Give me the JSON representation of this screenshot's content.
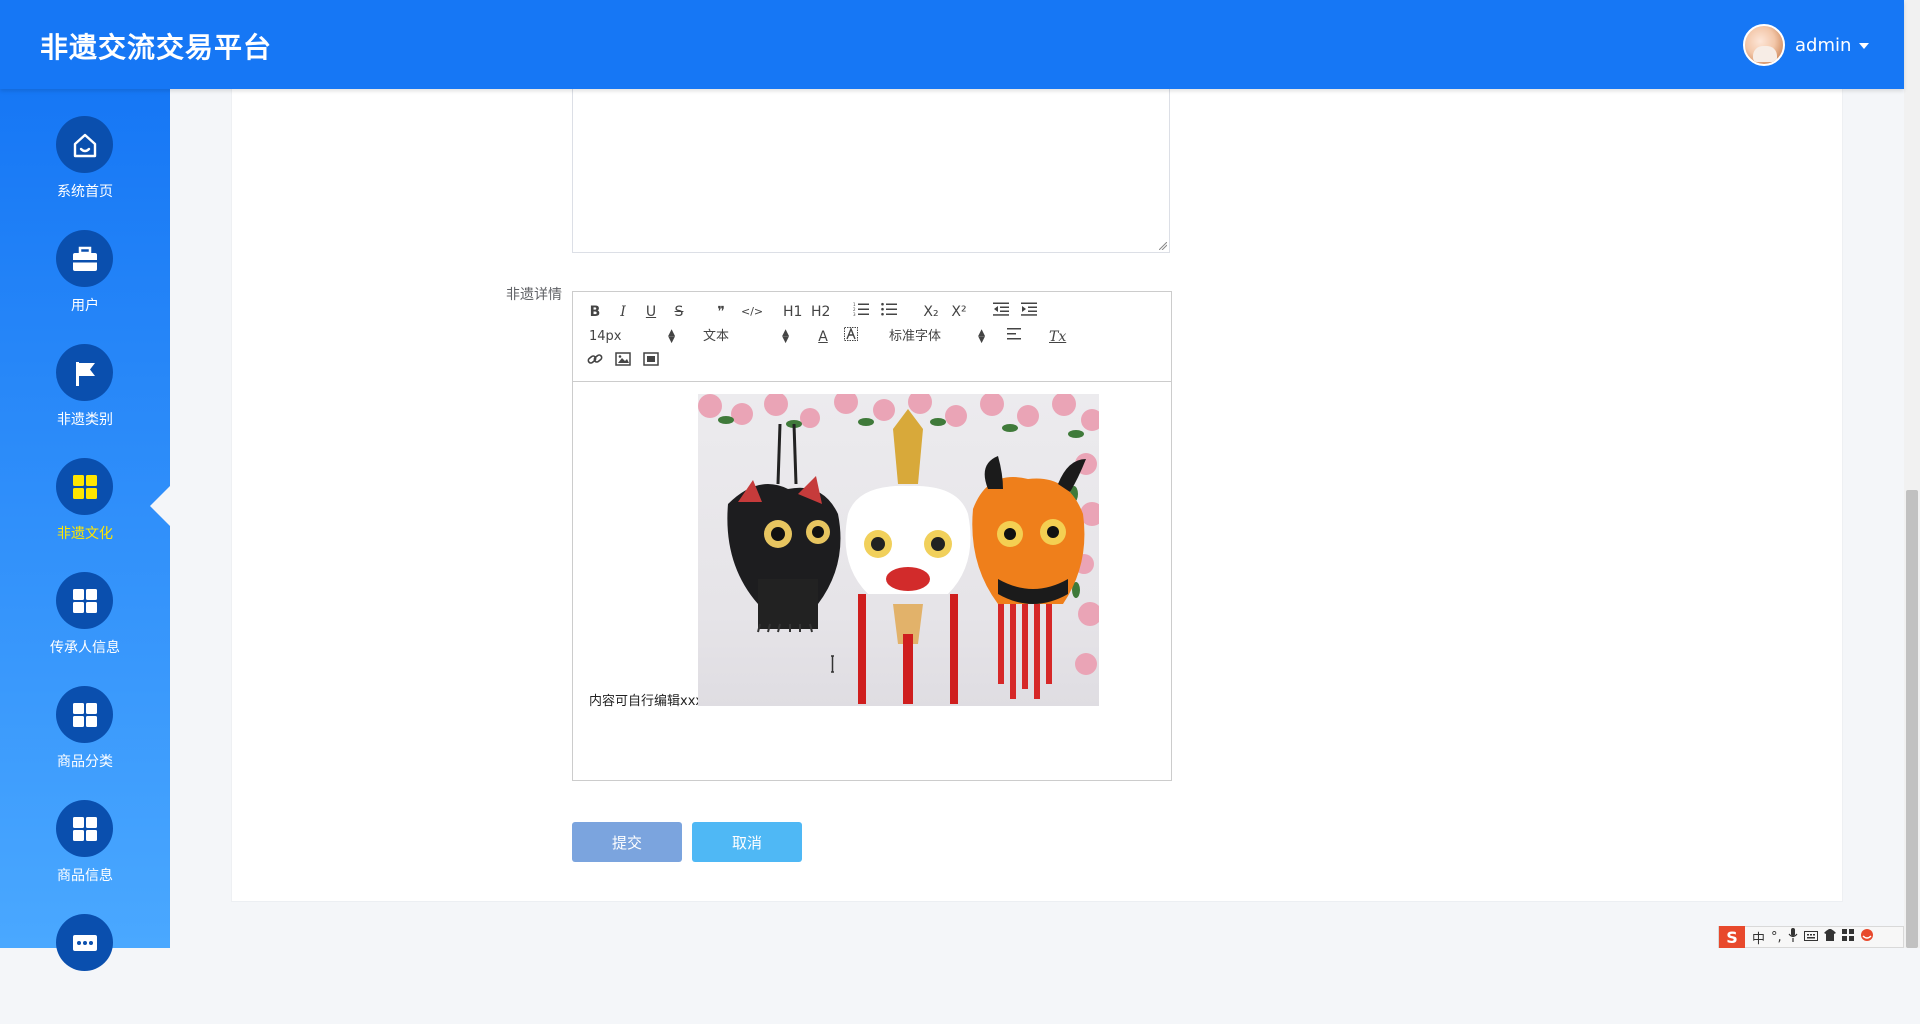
{
  "app": {
    "title": "非遗交流交易平台"
  },
  "user": {
    "name": "admin"
  },
  "sidebar": {
    "items": [
      {
        "label": "系统首页",
        "icon": "home-icon"
      },
      {
        "label": "用户",
        "icon": "briefcase-icon"
      },
      {
        "label": "非遗类别",
        "icon": "flag-icon"
      },
      {
        "label": "非遗文化",
        "icon": "grid-icon",
        "active": true
      },
      {
        "label": "传承人信息",
        "icon": "grid-icon"
      },
      {
        "label": "商品分类",
        "icon": "grid-icon"
      },
      {
        "label": "商品信息",
        "icon": "grid-icon"
      },
      {
        "label": "",
        "icon": "more-icon"
      }
    ],
    "active_color": "#ffe600"
  },
  "form": {
    "detail_label": "非遗详情",
    "editor": {
      "toolbar": {
        "row1": [
          "B",
          "I",
          "U",
          "S",
          "❞",
          "</>",
          "H1",
          "H2",
          "ordered-list",
          "bullet-list",
          "X₂",
          "X²",
          "outdent",
          "indent"
        ],
        "font_size": "14px",
        "header_select": "文本",
        "font_family": "标准字体",
        "text_color_glyph": "A",
        "clean_glyph": "Tx"
      },
      "content_text": "内容可自行编辑xxx"
    },
    "submit_label": "提交",
    "cancel_label": "取消"
  },
  "ime": {
    "logo": "S",
    "lang": "中"
  },
  "colors": {
    "topbar": "#1677f5",
    "submit": "#7ba4de",
    "cancel": "#4fb8f5"
  }
}
